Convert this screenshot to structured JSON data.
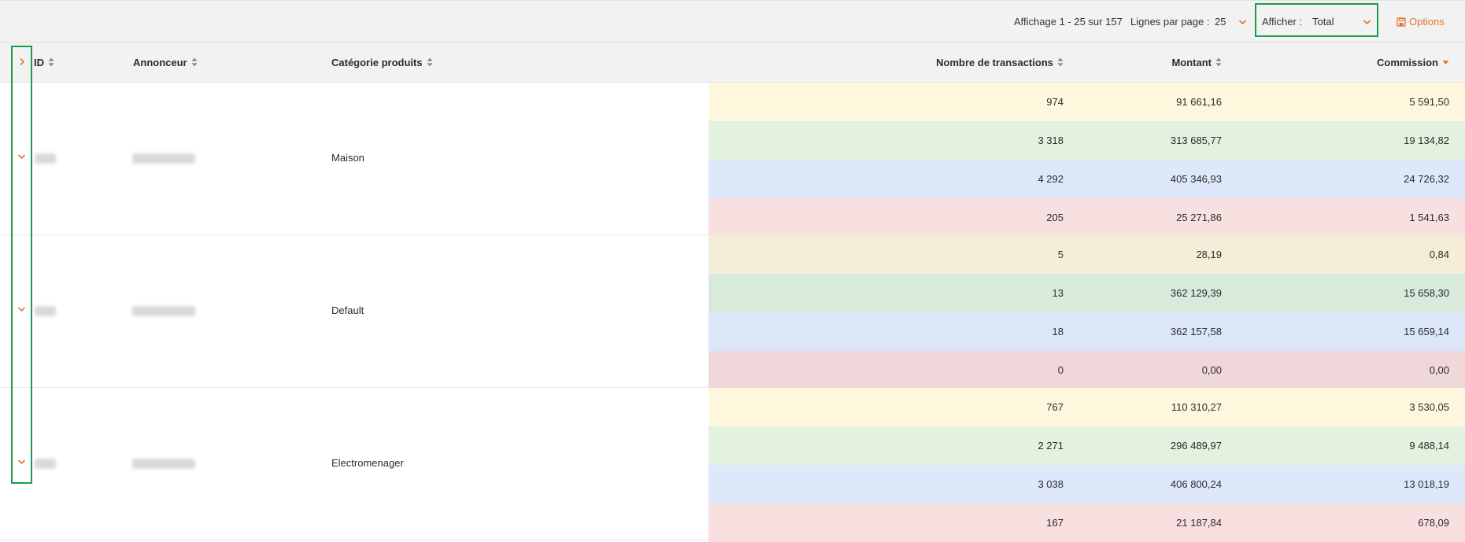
{
  "toolbar": {
    "pagination_info": "Affichage 1 - 25 sur 157",
    "rows_per_page_label": "Lignes par page :",
    "rows_per_page_value": "25",
    "show_label": "Afficher :",
    "show_value": "Total",
    "options_label": "Options"
  },
  "colors": {
    "accent": "#e8742d",
    "highlight_border": "#1e9a52",
    "row_yellow": "#fff7dd",
    "row_green": "#e2f2df",
    "row_blue": "#dde9fb",
    "row_red": "#f8e0e1",
    "row_yellow_dark": "#f4eed8",
    "row_green_dark": "#d8eadb",
    "row_blue_dark": "#dbe7f8",
    "row_red_dark": "#efd7da"
  },
  "table": {
    "columns": {
      "id": "ID",
      "annonceur": "Annonceur",
      "categorie": "Catégorie produits",
      "transactions": "Nombre de transactions",
      "montant": "Montant",
      "commission": "Commission"
    },
    "groups": [
      {
        "categorie": "Maison",
        "rows": [
          {
            "transactions": "974",
            "montant": "91 661,16",
            "commission": "5 591,50",
            "color": "#fff7dd"
          },
          {
            "transactions": "3 318",
            "montant": "313 685,77",
            "commission": "19 134,82",
            "color": "#e2f2df"
          },
          {
            "transactions": "4 292",
            "montant": "405 346,93",
            "commission": "24 726,32",
            "color": "#dde9fb"
          },
          {
            "transactions": "205",
            "montant": "25 271,86",
            "commission": "1 541,63",
            "color": "#f8e0e1"
          }
        ]
      },
      {
        "categorie": "Default",
        "rows": [
          {
            "transactions": "5",
            "montant": "28,19",
            "commission": "0,84",
            "color": "#f4eed8"
          },
          {
            "transactions": "13",
            "montant": "362 129,39",
            "commission": "15 658,30",
            "color": "#d8eadb"
          },
          {
            "transactions": "18",
            "montant": "362 157,58",
            "commission": "15 659,14",
            "color": "#dbe7f8"
          },
          {
            "transactions": "0",
            "montant": "0,00",
            "commission": "0,00",
            "color": "#efd7da"
          }
        ]
      },
      {
        "categorie": "Electromenager",
        "rows": [
          {
            "transactions": "767",
            "montant": "110 310,27",
            "commission": "3 530,05",
            "color": "#fff7dd"
          },
          {
            "transactions": "2 271",
            "montant": "296 489,97",
            "commission": "9 488,14",
            "color": "#e2f2df"
          },
          {
            "transactions": "3 038",
            "montant": "406 800,24",
            "commission": "13 018,19",
            "color": "#dde9fb"
          },
          {
            "transactions": "167",
            "montant": "21 187,84",
            "commission": "678,09",
            "color": "#f8e0e1"
          }
        ]
      }
    ]
  }
}
